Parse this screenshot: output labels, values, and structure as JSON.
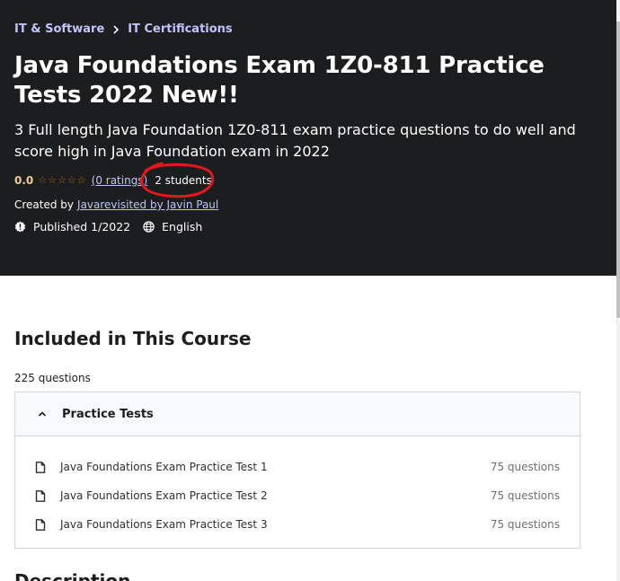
{
  "breadcrumb": [
    {
      "label": "IT & Software"
    },
    {
      "label": "IT Certifications"
    }
  ],
  "course": {
    "title": "Java Foundations Exam 1Z0-811 Practice Tests 2022 New!!",
    "subtitle": "3 Full length Java Foundation 1Z0-811 exam practice questions to do well and score high in Java Foundation exam in 2022",
    "rating_score": "0.0",
    "ratings_link": "(0 ratings)",
    "students": "2 students",
    "created_by_label": "Created by",
    "creators": "Javarevisited by Javin Paul",
    "published": "Published 1/2022",
    "language": "English"
  },
  "included": {
    "title": "Included in This Course",
    "question_count": "225 questions",
    "section": {
      "title": "Practice Tests",
      "items": [
        {
          "label": "Java Foundations Exam Practice Test 1",
          "count": "75 questions"
        },
        {
          "label": "Java Foundations Exam Practice Test 2",
          "count": "75 questions"
        },
        {
          "label": "Java Foundations Exam Practice Test 3",
          "count": "75 questions"
        }
      ]
    }
  },
  "next_section": {
    "title": "Description"
  },
  "colors": {
    "hero_bg": "#1c1d1f",
    "link_purple": "#c0c4fc",
    "rating_gold": "#f3ca8c",
    "annotation_red": "#e0181d"
  },
  "icons": {
    "breadcrumb_separator": "chevron-right-icon",
    "published": "alert-badge-icon",
    "language": "globe-icon",
    "accordion": "chevron-up-icon",
    "item": "document-icon"
  }
}
